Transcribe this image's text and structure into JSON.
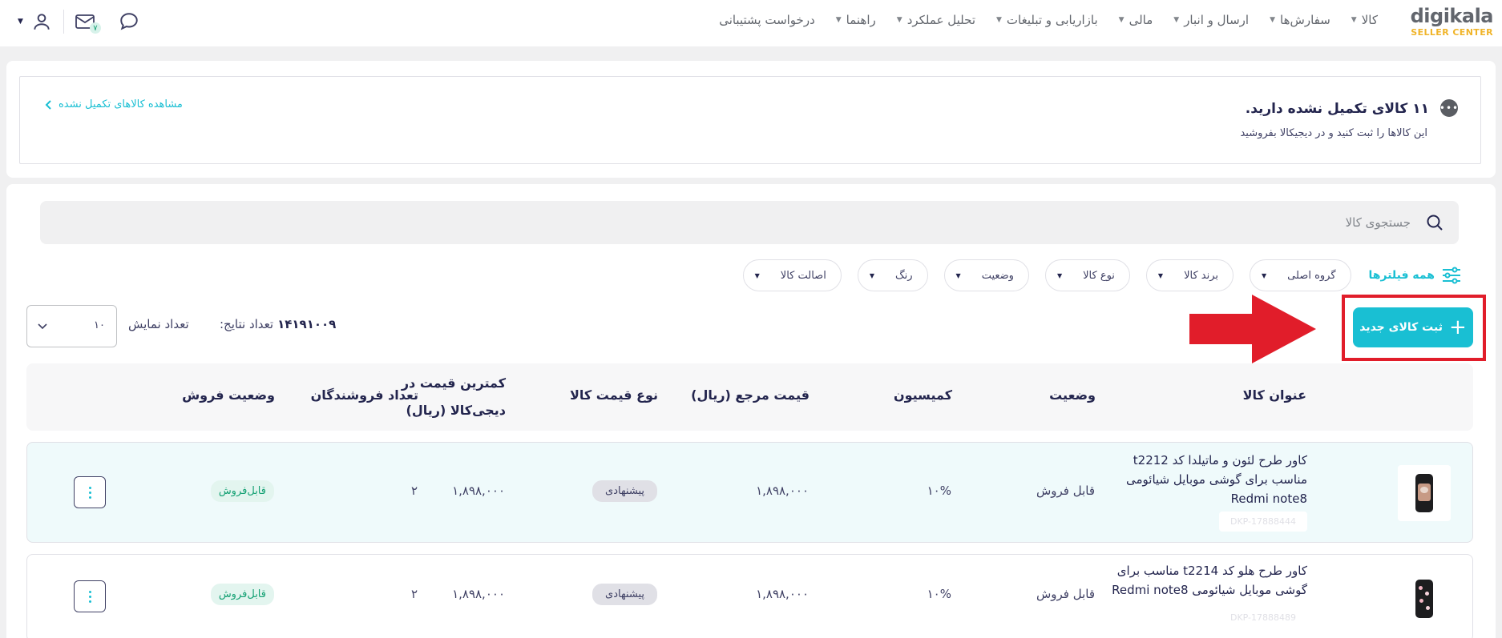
{
  "logo": {
    "main": "digikala",
    "sub": "SELLER CENTER"
  },
  "nav": {
    "items": [
      {
        "label": "کالا",
        "has_caret": true
      },
      {
        "label": "سفارش‌ها",
        "has_caret": true
      },
      {
        "label": "ارسال و انبار",
        "has_caret": true
      },
      {
        "label": "مالی",
        "has_caret": true
      },
      {
        "label": "بازاریابی و تبلیغات",
        "has_caret": true
      },
      {
        "label": "تحلیل عملکرد",
        "has_caret": true
      },
      {
        "label": "راهنما",
        "has_caret": true
      },
      {
        "label": "درخواست پشتیبانی",
        "has_caret": false
      }
    ],
    "messages_badge": "۷"
  },
  "notice": {
    "title": "۱۱ کالای تکمیل نشده دارید.",
    "subtitle": "این کالاها را ثبت کنید و در دیجیکالا بفروشید",
    "link": "مشاهده کالاهای تکمیل نشده"
  },
  "search": {
    "placeholder": "جستجوی کالا"
  },
  "filters": {
    "all_label": "همه فیلترها",
    "chips": [
      "گروه اصلی",
      "برند کالا",
      "نوع کالا",
      "وضعیت",
      "رنگ",
      "اصالت کالا"
    ]
  },
  "add_button": {
    "label": "ثبت کالای جدید"
  },
  "results": {
    "label": "تعداد نتایج:",
    "count": "۱۴۱۹۱۰۰۹"
  },
  "page_size": {
    "label": "تعداد نمایش",
    "value": "۱۰"
  },
  "table": {
    "headers": {
      "title": "عنوان کالا",
      "status": "وضعیت",
      "commission": "کمیسیون",
      "ref_price": "قیمت مرجع (ریال)",
      "price_type": "نوع قیمت کالا",
      "min_price_line1": "کمترین قیمت در",
      "min_price_line2": "دیجی‌کالا (ریال)",
      "sellers": "تعداد فروشندگان",
      "sale_status": "وضعیت فروش"
    },
    "rows": [
      {
        "title_lines": [
          "کاور طرح لئون و ماتیلدا کد t2212",
          "مناسب برای گوشی موبایل شیائومی",
          "Redmi note8"
        ],
        "dkp": "DKP-17888444",
        "status": "قابل فروش",
        "commission": "۱۰%",
        "ref_price": "۱,۸۹۸,۰۰۰",
        "price_type": "پیشنهادی",
        "min_price": "۱,۸۹۸,۰۰۰",
        "sellers": "۲",
        "sale_status": "قابل‌فروش"
      },
      {
        "title_lines": [
          "کاور طرح هلو کد t2214 مناسب برای",
          "گوشی موبایل شیائومی Redmi note8"
        ],
        "dkp": "DKP-17888489",
        "status": "قابل فروش",
        "commission": "۱۰%",
        "ref_price": "۱,۸۹۸,۰۰۰",
        "price_type": "پیشنهادی",
        "min_price": "۱,۸۹۸,۰۰۰",
        "sellers": "۲",
        "sale_status": "قابل‌فروش"
      }
    ]
  },
  "colors": {
    "accent": "#19bfd3",
    "highlight": "#e11d2a",
    "green": "#15a174"
  },
  "icons": [
    "user-icon",
    "mail-icon",
    "chat-icon",
    "search-icon",
    "filters-icon",
    "plus-icon",
    "chevron-left-icon",
    "chevron-down-icon",
    "more-icon",
    "kebab-icon"
  ]
}
